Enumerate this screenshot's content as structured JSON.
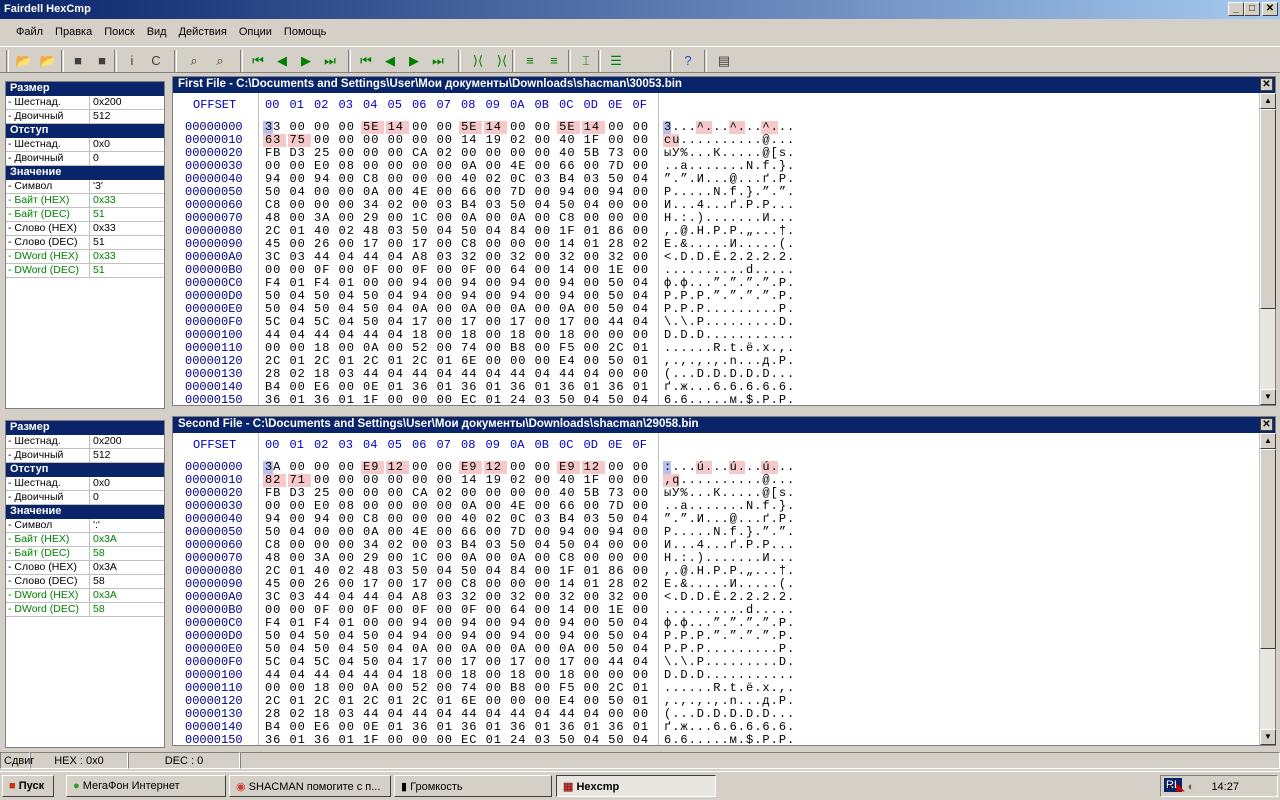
{
  "window": {
    "title": "Fairdell HexCmp",
    "minimize": "_",
    "maximize": "□",
    "close": "✕"
  },
  "menu": [
    "Файл",
    "Правка",
    "Поиск",
    "Вид",
    "Действия",
    "Опции",
    "Помощь"
  ],
  "toolbar": [
    "open-file1-icon",
    "open-file2-icon",
    "stop-icon",
    "stop2-icon",
    "info-icon",
    "compare-icon",
    "find-icon",
    "find-next-icon",
    "first-diff-icon",
    "prev-diff-icon",
    "next-diff-icon",
    "last-diff-icon",
    "first-block-icon",
    "prev-block-icon",
    "next-block-icon",
    "last-block-icon",
    "sync-icon",
    "unsync-icon",
    "align-up-icon",
    "align-down-icon",
    "block-icon",
    "list-icon",
    "help-icon",
    "report-icon"
  ],
  "toolbar_glyphs": [
    "📂",
    "📂",
    "■",
    "■",
    "i",
    "C",
    "⌕",
    "⌕",
    "⏮",
    "◀",
    "▶",
    "⏭",
    "⏮",
    "◀",
    "▶",
    "⏭",
    "⟩⟨",
    "⟩⟨",
    "≡",
    "≡",
    "⌶",
    "☰",
    "?",
    "▤"
  ],
  "header": {
    "offset": "OFFSET",
    "cols": [
      "00",
      "01",
      "02",
      "03",
      "04",
      "05",
      "06",
      "07",
      "08",
      "09",
      "0A",
      "0B",
      "0C",
      "0D",
      "0E",
      "0F"
    ]
  },
  "files": [
    {
      "title": "First File - C:\\Documents and Settings\\User\\Мои документы\\Downloads\\shacman\\30053.bin",
      "info": [
        {
          "head": "Размер"
        },
        {
          "k": "- Шестнад.",
          "v": "0x200"
        },
        {
          "k": "- Двоичный",
          "v": "512"
        },
        {
          "head": "Отступ"
        },
        {
          "k": "- Шестнад.",
          "v": "0x0"
        },
        {
          "k": "- Двоичный",
          "v": "0"
        },
        {
          "head": "Значение"
        },
        {
          "k": "- Символ",
          "v": "'3'"
        },
        {
          "k": "- Байт (HEX)",
          "v": "0x33",
          "g": 1
        },
        {
          "k": "- Байт (DEC)",
          "v": "51",
          "g": 1
        },
        {
          "k": "- Слово (HEX)",
          "v": "0x33"
        },
        {
          "k": "- Слово (DEC)",
          "v": "51"
        },
        {
          "k": "- DWord (HEX)",
          "v": "0x33",
          "g": 1
        },
        {
          "k": "- DWord (DEC)",
          "v": "51",
          "g": 1
        }
      ],
      "rows": [
        [
          "00000000",
          "33 00 00 00 5E 14 00 00 5E 14 00 00 5E 14 00 00",
          "3...^...^...^..."
        ],
        [
          "00000010",
          "63 75 00 00 00 00 00 00 14 19 02 00 40 1F 00 00",
          "cu..........@..."
        ]
      ]
    },
    {
      "title": "Second File - C:\\Documents and Settings\\User\\Мои документы\\Downloads\\shacman\\29058.bin",
      "info": [
        {
          "head": "Размер"
        },
        {
          "k": "- Шестнад.",
          "v": "0x200"
        },
        {
          "k": "- Двоичный",
          "v": "512"
        },
        {
          "head": "Отступ"
        },
        {
          "k": "- Шестнад.",
          "v": "0x0"
        },
        {
          "k": "- Двоичный",
          "v": "0"
        },
        {
          "head": "Значение"
        },
        {
          "k": "- Символ",
          "v": "':'"
        },
        {
          "k": "- Байт (HEX)",
          "v": "0x3A",
          "g": 1
        },
        {
          "k": "- Байт (DEC)",
          "v": "58",
          "g": 1
        },
        {
          "k": "- Слово (HEX)",
          "v": "0x3A"
        },
        {
          "k": "- Слово (DEC)",
          "v": "58"
        },
        {
          "k": "- DWord (HEX)",
          "v": "0x3A",
          "g": 1
        },
        {
          "k": "- DWord (DEC)",
          "v": "58",
          "g": 1
        }
      ],
      "rows": [
        [
          "00000000",
          "3A 00 00 00 E9 12 00 00 E9 12 00 00 E9 12 00 00",
          ":...ú...ú...ú..."
        ],
        [
          "00000010",
          "82 71 00 00 00 00 00 00 14 19 02 00 40 1F 00 00",
          "‚q..........@..."
        ]
      ]
    }
  ],
  "common_rows": [
    [
      "00000020",
      "FB D3 25 00 00 00 CA 02 00 00 00 00 40 5B 73 00",
      "ыУ%...К.....@[s."
    ],
    [
      "00000030",
      "00 00 E0 08 00 00 00 00 0A 00 4E 00 66 00 7D 00",
      "..а.......N.f.}."
    ],
    [
      "00000040",
      "94 00 94 00 C8 00 00 00 40 02 0C 03 B4 03 50 04",
      "”.”.И...@...ґ.P."
    ],
    [
      "00000050",
      "50 04 00 00 0A 00 4E 00 66 00 7D 00 94 00 94 00",
      "P.....N.f.}.”.”."
    ],
    [
      "00000060",
      "C8 00 00 00 34 02 00 03 B4 03 50 04 50 04 00 00",
      "И...4...ґ.P.P..."
    ],
    [
      "00000070",
      "48 00 3A 00 29 00 1C 00 0A 00 0A 00 C8 00 00 00",
      "H.:.).......И..."
    ],
    [
      "00000080",
      "2C 01 40 02 48 03 50 04 50 04 84 00 1F 01 86 00",
      ",.@.H.P.P.„...†."
    ],
    [
      "00000090",
      "45 00 26 00 17 00 17 00 C8 00 00 00 14 01 28 02",
      "E.&.....И.....(."
    ],
    [
      "000000A0",
      "3C 03 44 04 44 04 A8 03 32 00 32 00 32 00 32 00",
      "<.D.D.Ё.2.2.2.2."
    ],
    [
      "000000B0",
      "00 00 0F 00 0F 00 0F 00 0F 00 64 00 14 00 1E 00",
      "..........d....."
    ],
    [
      "000000C0",
      "F4 01 F4 01 00 00 94 00 94 00 94 00 94 00 50 04",
      "ф.ф...”.”.”.”.P."
    ],
    [
      "000000D0",
      "50 04 50 04 50 04 94 00 94 00 94 00 94 00 50 04",
      "P.P.P.”.”.”.”.P."
    ],
    [
      "000000E0",
      "50 04 50 04 50 04 0A 00 0A 00 0A 00 0A 00 50 04",
      "P.P.P.........P."
    ],
    [
      "000000F0",
      "5C 04 5C 04 50 04 17 00 17 00 17 00 17 00 44 04",
      "\\.\\.P.........D."
    ],
    [
      "00000100",
      "44 04 44 04 44 04 18 00 18 00 18 00 18 00 00 00",
      "D.D.D..........."
    ],
    [
      "00000110",
      "00 00 18 00 0A 00 52 00 74 00 B8 00 F5 00 2C 01",
      "......R.t.ё.х.,."
    ],
    [
      "00000120",
      "2C 01 2C 01 2C 01 2C 01 6E 00 00 00 E4 00 50 01",
      ",.,.,.,.n...д.P."
    ],
    [
      "00000130",
      "28 02 18 03 44 04 44 04 44 04 44 04 44 04 00 00",
      "(...D.D.D.D.D..."
    ],
    [
      "00000140",
      "B4 00 E6 00 0E 01 36 01 36 01 36 01 36 01 36 01",
      "ґ.ж...6.6.6.6.6."
    ],
    [
      "00000150",
      "36 01 36 01 1F 00 00 00 EC 01 24 03 50 04 50 04",
      "6.6.....м.$.P.P."
    ]
  ],
  "diff_bytes": [
    [
      0,
      4
    ],
    [
      0,
      5
    ],
    [
      0,
      8
    ],
    [
      0,
      9
    ],
    [
      0,
      12
    ],
    [
      0,
      13
    ],
    [
      1,
      0
    ],
    [
      1,
      1
    ]
  ],
  "cursor": [
    0,
    0
  ],
  "status": {
    "mode": "Сдвиг",
    "hex": "HEX : 0x0",
    "dec": "DEC : 0"
  },
  "taskbar": {
    "start": "Пуск",
    "tasks": [
      "МегаФон Интернет",
      "SHACMAN помогите с п...",
      "Громкость",
      "Hexcmp"
    ],
    "lang": "RL",
    "clock": "14:27"
  },
  "colors": {
    "title": "#0a246a",
    "diff": "#f5c9c9",
    "cursor": "#3050c8"
  }
}
